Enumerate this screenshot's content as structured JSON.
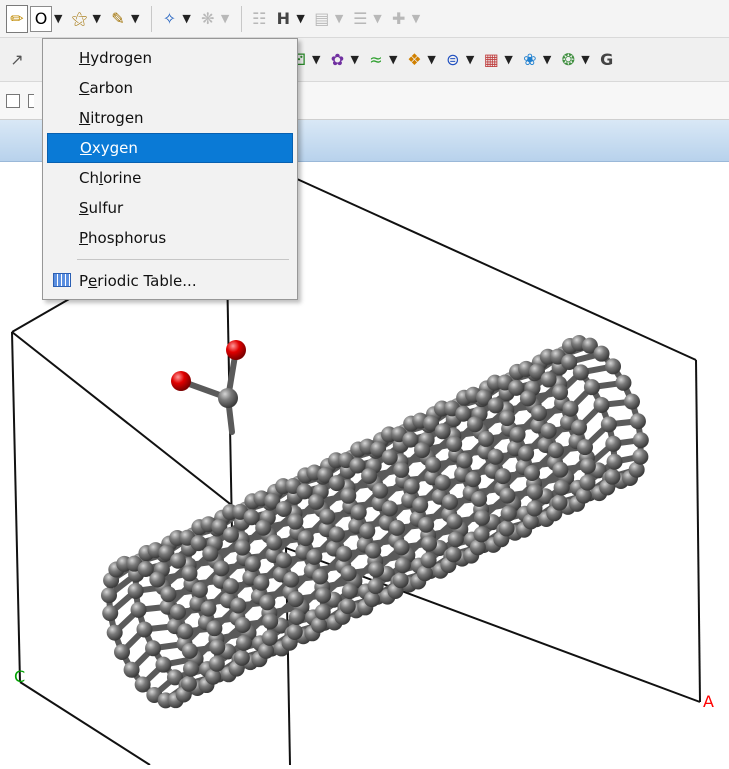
{
  "toolbar_row1": {
    "element_button_text": "O",
    "icons": [
      "pencil-icon",
      "element-selector",
      "ring-sketch-icon",
      "chain-sketch-icon",
      "clean-icon",
      "symmetry-icon",
      "hydrogen-adjust-icon",
      "hybrid-icon",
      "align-icon",
      "distribute-icon",
      "measure-icon"
    ]
  },
  "element_menu": {
    "items": [
      {
        "label": "Hydrogen",
        "mnemonic": "H",
        "rest": "ydrogen"
      },
      {
        "label": "Carbon",
        "mnemonic": "C",
        "rest": "arbon"
      },
      {
        "label": "Nitrogen",
        "mnemonic": "N",
        "rest": "itrogen"
      },
      {
        "label": "Oxygen",
        "mnemonic": "O",
        "rest": "xygen",
        "selected": true
      },
      {
        "label": "Chlorine",
        "pre": "Ch",
        "mnemonic": "l",
        "rest": "orine"
      },
      {
        "label": "Sulfur",
        "mnemonic": "S",
        "rest": "ulfur"
      },
      {
        "label": "Phosphorus",
        "mnemonic": "P",
        "rest": "hosphorus"
      }
    ],
    "periodic_table": {
      "pre": "P",
      "mnemonic": "e",
      "rest": "riodic Table..."
    }
  },
  "viewport": {
    "axis_labels": {
      "a": "A",
      "c": "C"
    },
    "colors": {
      "background": "#ffffff",
      "carbon": "#6e6e6e",
      "oxygen": "#e00000",
      "axis_a": "#ff0000",
      "axis_c": "#00a000"
    }
  }
}
